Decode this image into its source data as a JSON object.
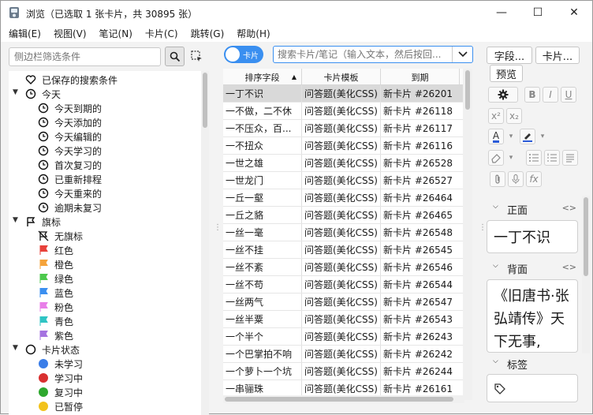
{
  "window": {
    "title": "浏览（已选取 1 张卡片，共 30895 张）",
    "minimize": "—",
    "maximize": "☐",
    "close": "✕"
  },
  "menu": [
    "编辑(E)",
    "视图(V)",
    "笔记(N)",
    "卡片(C)",
    "跳转(G)",
    "帮助(H)"
  ],
  "sidebar": {
    "search_placeholder": "侧边栏筛选条件",
    "saved_searches": "已保存的搜索条件",
    "today": {
      "label": "今天",
      "items": [
        "今天到期的",
        "今天添加的",
        "今天编辑的",
        "今天学习的",
        "首次复习的",
        "已重新排程",
        "今天重来的",
        "逾期未复习"
      ]
    },
    "flags": {
      "label": "旗标",
      "items": [
        {
          "label": "无旗标",
          "color": "none"
        },
        {
          "label": "红色",
          "color": "#e8413a"
        },
        {
          "label": "橙色",
          "color": "#f5a33a"
        },
        {
          "label": "绿色",
          "color": "#4cc94c"
        },
        {
          "label": "蓝色",
          "color": "#3a8ff0"
        },
        {
          "label": "粉色",
          "color": "#e87ee8"
        },
        {
          "label": "青色",
          "color": "#2fc4c4"
        },
        {
          "label": "紫色",
          "color": "#a573e0"
        }
      ]
    },
    "card_state": {
      "label": "卡片状态",
      "items": [
        {
          "label": "未学习",
          "color": "#3a7de8"
        },
        {
          "label": "学习中",
          "color": "#d93030"
        },
        {
          "label": "复习中",
          "color": "#2ea82e"
        },
        {
          "label": "已暂停",
          "color": "#f2c21b"
        }
      ]
    }
  },
  "toolbar": {
    "toggle_label": "卡片",
    "search_placeholder": "搜索卡片/笔记（输入文本，然后按回..."
  },
  "table": {
    "columns": [
      "排序字段",
      "卡片模板",
      "到期"
    ],
    "rows": [
      [
        "一丁不识",
        "问答题(美化CSS)",
        "新卡片 #26201"
      ],
      [
        "一不做，二不休",
        "问答题(美化CSS)",
        "新卡片 #26118"
      ],
      [
        "一不压众，百...",
        "问答题(美化CSS)",
        "新卡片 #26117"
      ],
      [
        "一不扭众",
        "问答题(美化CSS)",
        "新卡片 #26116"
      ],
      [
        "一世之雄",
        "问答题(美化CSS)",
        "新卡片 #26528"
      ],
      [
        "一世龙门",
        "问答题(美化CSS)",
        "新卡片 #26527"
      ],
      [
        "一丘一壑",
        "问答题(美化CSS)",
        "新卡片 #26464"
      ],
      [
        "一丘之貉",
        "问答题(美化CSS)",
        "新卡片 #26465"
      ],
      [
        "一丝一毫",
        "问答题(美化CSS)",
        "新卡片 #26548"
      ],
      [
        "一丝不挂",
        "问答题(美化CSS)",
        "新卡片 #26545"
      ],
      [
        "一丝不紊",
        "问答题(美化CSS)",
        "新卡片 #26546"
      ],
      [
        "一丝不苟",
        "问答题(美化CSS)",
        "新卡片 #26544"
      ],
      [
        "一丝两气",
        "问答题(美化CSS)",
        "新卡片 #26547"
      ],
      [
        "一丝半粟",
        "问答题(美化CSS)",
        "新卡片 #26543"
      ],
      [
        "一个半个",
        "问答题(美化CSS)",
        "新卡片 #26243"
      ],
      [
        "一个巴掌拍不响",
        "问答题(美化CSS)",
        "新卡片 #26242"
      ],
      [
        "一个萝卜一个坑",
        "问答题(美化CSS)",
        "新卡片 #26244"
      ],
      [
        "一串骊珠",
        "问答题(美化CSS)",
        "新卡片 #26161"
      ]
    ]
  },
  "editor": {
    "fields_btn": "字段...",
    "cards_btn": "卡片...",
    "preview_btn": "预览",
    "front_label": "正面",
    "front_value": "一丁不识",
    "back_label": "背面",
    "back_value": "《旧唐书·张弘靖传》天下无事,",
    "tags_label": "标签",
    "html_toggle": "<>",
    "format": {
      "bold": "B",
      "italic": "I",
      "underline": "U",
      "superscript": "x²",
      "subscript": "x₂"
    },
    "text_color": "#2b5bd7",
    "highlight_color": "#2b5bd7"
  }
}
